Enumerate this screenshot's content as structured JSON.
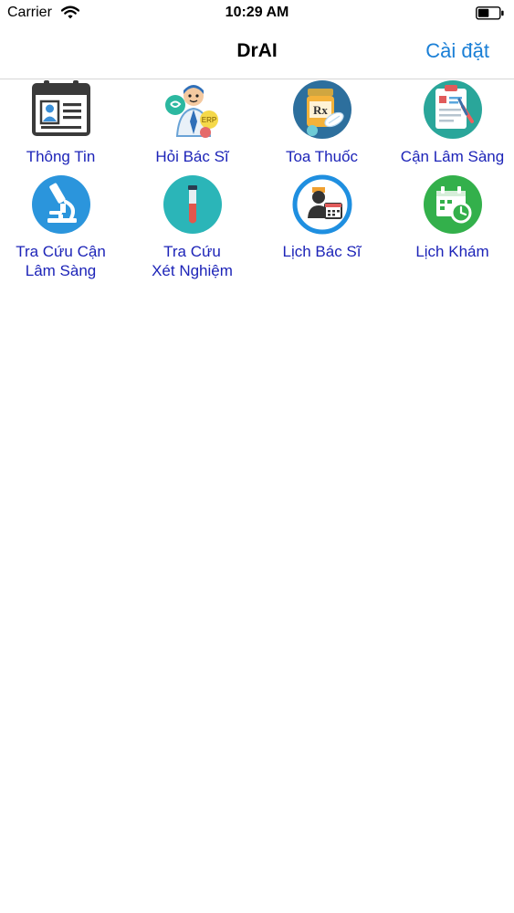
{
  "status_bar": {
    "carrier": "Carrier",
    "time": "10:29 AM"
  },
  "nav": {
    "title": "DrAI",
    "settings_label": "Cài đặt"
  },
  "menu": {
    "items": [
      {
        "label": "Thông Tin",
        "icon": "id-card-icon"
      },
      {
        "label": "Hỏi Bác Sĩ",
        "icon": "doctor-chat-icon"
      },
      {
        "label": "Toa Thuốc",
        "icon": "prescription-bottle-icon"
      },
      {
        "label": "Cận Lâm Sàng",
        "icon": "medical-clipboard-icon"
      },
      {
        "label": "Tra Cứu Cận\nLâm Sàng",
        "icon": "microscope-icon"
      },
      {
        "label": "Tra Cứu\nXét Nghiệm",
        "icon": "test-tube-icon"
      },
      {
        "label": "Lịch Bác Sĩ",
        "icon": "doctor-calendar-icon"
      },
      {
        "label": "Lịch Khám",
        "icon": "calendar-clock-icon"
      }
    ]
  },
  "colors": {
    "accent": "#1a7fd6",
    "label": "#1d24b8"
  }
}
